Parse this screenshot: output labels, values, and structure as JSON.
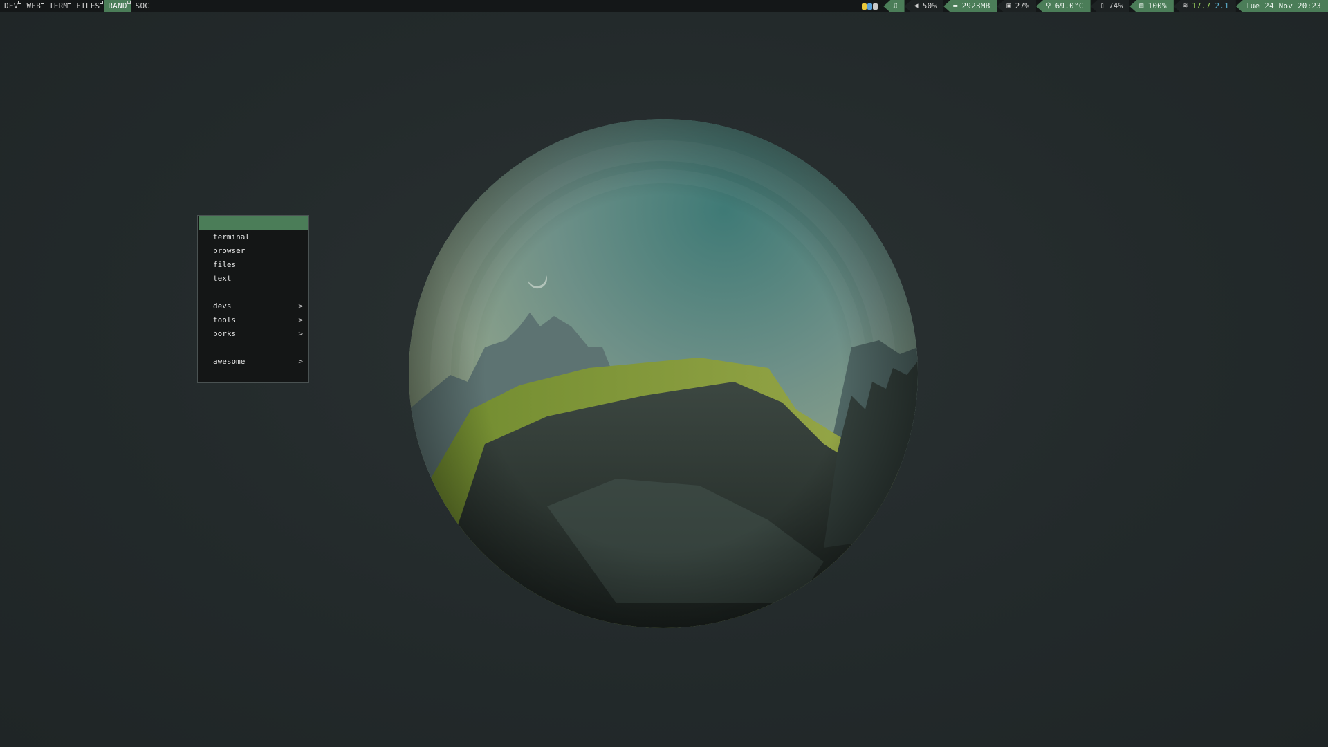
{
  "topbar": {
    "tags": [
      {
        "label": "DEV",
        "active": false,
        "occupied": true
      },
      {
        "label": "WEB",
        "active": false,
        "occupied": true
      },
      {
        "label": "TERM",
        "active": false,
        "occupied": true
      },
      {
        "label": "FILES",
        "active": false,
        "occupied": true
      },
      {
        "label": "RAND",
        "active": true,
        "occupied": true
      },
      {
        "label": "SOC",
        "active": false,
        "occupied": false
      }
    ],
    "music_icon": "♫",
    "volume": "50%",
    "memory": "2923MB",
    "cpu": "27%",
    "temperature": "69.0°C",
    "battery": "74%",
    "disk": "100%",
    "net_up": "17.7",
    "net_down": "2.1",
    "clock": "Tue 24 Nov 20:23"
  },
  "menu": {
    "items": [
      {
        "label": "terminal",
        "submenu": false
      },
      {
        "label": "browser",
        "submenu": false
      },
      {
        "label": "files",
        "submenu": false
      },
      {
        "label": "text",
        "submenu": false
      },
      {
        "label": "devs",
        "submenu": true
      },
      {
        "label": "tools",
        "submenu": true
      },
      {
        "label": "borks",
        "submenu": true
      },
      {
        "label": "awesome",
        "submenu": true
      }
    ],
    "arrow": ">"
  },
  "colors": {
    "accent": "#4b7d58",
    "bar_bg": "#141718",
    "desktop_bg": "#262d2e",
    "net_up": "#9bd55f",
    "net_down": "#5fb6d5"
  }
}
